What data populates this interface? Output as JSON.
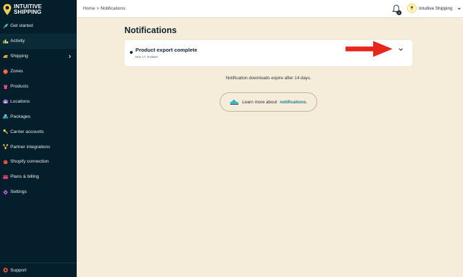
{
  "brand": {
    "line1": "INTUITIVE",
    "line2": "SHIPPING",
    "accent": "#f2c94c"
  },
  "sidebar": {
    "items": [
      {
        "label": "Get started",
        "icon": "rocket-icon"
      },
      {
        "label": "Activity",
        "icon": "activity-icon",
        "active": true
      },
      {
        "label": "Shipping",
        "icon": "shipping-icon",
        "has_submenu": true
      },
      {
        "label": "Zones",
        "icon": "globe-icon"
      },
      {
        "label": "Products",
        "icon": "shirt-icon"
      },
      {
        "label": "Locations",
        "icon": "warehouse-icon"
      },
      {
        "label": "Packages",
        "icon": "packages-icon"
      },
      {
        "label": "Carrier accounts",
        "icon": "key-icon"
      },
      {
        "label": "Partner integrations",
        "icon": "integrations-icon"
      },
      {
        "label": "Shopify connection",
        "icon": "shopify-icon"
      },
      {
        "label": "Plans & billing",
        "icon": "billing-icon"
      },
      {
        "label": "Settings",
        "icon": "gear-icon"
      }
    ],
    "support_label": "Support"
  },
  "header": {
    "breadcrumb": {
      "home": "Home",
      "separator": ">",
      "current": "Notifications"
    },
    "bell_count": "1",
    "user_name": "Intuitive Shipping"
  },
  "main": {
    "title": "Notifications",
    "notification": {
      "title": "Product export complete",
      "time": "Nov 17, 9:49am"
    },
    "expire_note": "Notification downloads expire after 14 days.",
    "learn_more": {
      "text": "Learn more about",
      "link": "notifications."
    }
  },
  "colors": {
    "sidebar_bg": "#041f2b",
    "page_bg": "#f5ecd9",
    "link": "#1f7a8a",
    "arrow": "#e8261c"
  }
}
